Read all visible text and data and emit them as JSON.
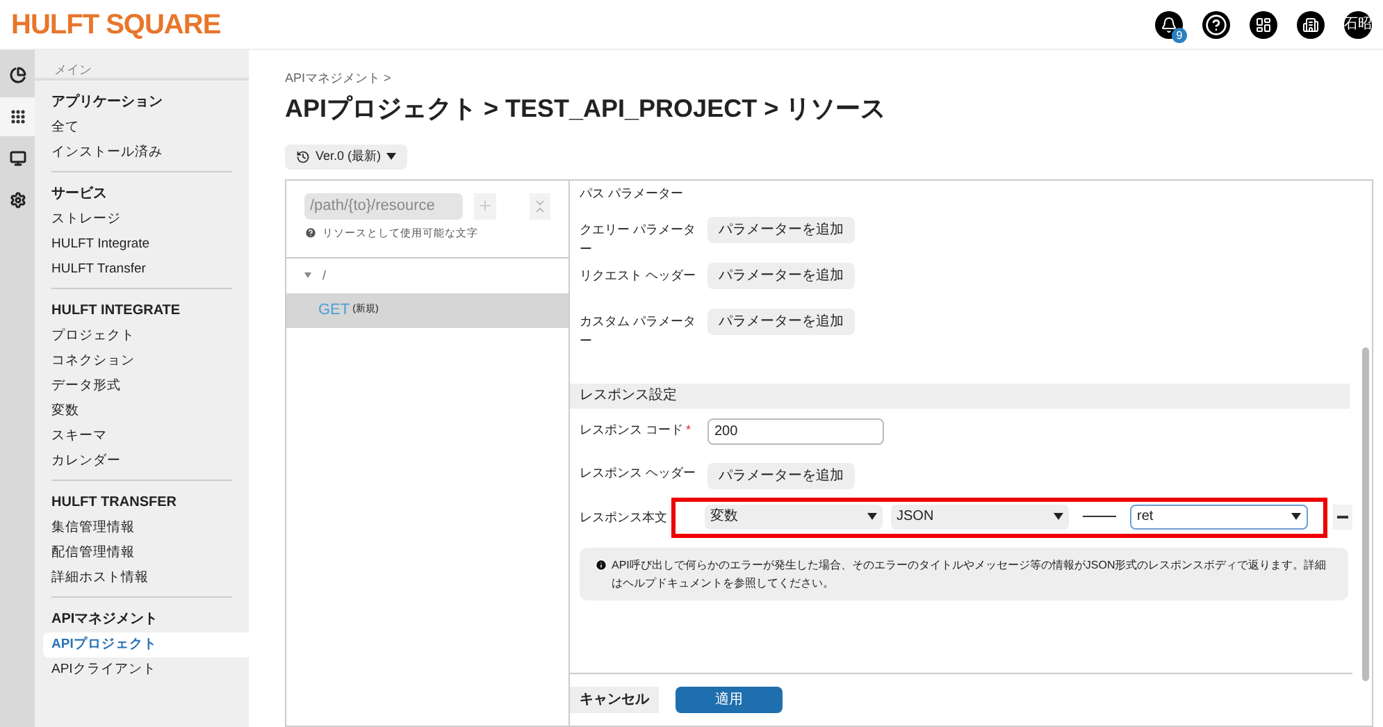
{
  "header": {
    "logo": "HULFT SQUARE",
    "notification_count": "9",
    "user": "石昭"
  },
  "rail": [
    {
      "kind": "chart",
      "selected": false
    },
    {
      "kind": "apps",
      "selected": true
    },
    {
      "kind": "monitor",
      "selected": false
    },
    {
      "kind": "settings",
      "selected": false
    }
  ],
  "sidebar": {
    "top_label": "メイン",
    "groups": [
      {
        "heading": "アプリケーション",
        "items": [
          {
            "label": "全て",
            "selected": false
          },
          {
            "label": "インストール済み",
            "selected": false
          }
        ]
      },
      {
        "heading": "サービス",
        "items": [
          {
            "label": "ストレージ",
            "selected": false
          },
          {
            "label": "HULFT Integrate",
            "selected": false
          },
          {
            "label": "HULFT Transfer",
            "selected": false
          }
        ]
      },
      {
        "heading": "HULFT INTEGRATE",
        "items": [
          {
            "label": "プロジェクト",
            "selected": false
          },
          {
            "label": "コネクション",
            "selected": false
          },
          {
            "label": "データ形式",
            "selected": false
          },
          {
            "label": "変数",
            "selected": false
          },
          {
            "label": "スキーマ",
            "selected": false
          },
          {
            "label": "カレンダー",
            "selected": false
          }
        ]
      },
      {
        "heading": "HULFT TRANSFER",
        "items": [
          {
            "label": "集信管理情報",
            "selected": false
          },
          {
            "label": "配信管理情報",
            "selected": false
          },
          {
            "label": "詳細ホスト情報",
            "selected": false
          }
        ]
      },
      {
        "heading": "APIマネジメント",
        "items": [
          {
            "label": "APIプロジェクト",
            "selected": true
          },
          {
            "label": "APIクライアント",
            "selected": false
          }
        ]
      }
    ]
  },
  "breadcrumb": "APIマネジメント >",
  "title": "APIプロジェクト > TEST_API_PROJECT > リソース",
  "version": "Ver.0 (最新)",
  "resource_panel": {
    "path_placeholder": "/path/{to}/resource",
    "hint": "リソースとして使用可能な文字",
    "tree": [
      {
        "label": "/",
        "expanded": true,
        "children": [
          {
            "method": "GET",
            "note": "(新規)",
            "selected": true
          }
        ]
      }
    ]
  },
  "request": {
    "path_params_label": "パス パラメーター",
    "rows": [
      {
        "label": "クエリー パラメーター",
        "button": "パラメーターを追加"
      },
      {
        "label": "リクエスト ヘッダー",
        "button": "パラメーターを追加"
      },
      {
        "label": "カスタム パラメーター",
        "button": "パラメーターを追加"
      }
    ]
  },
  "response": {
    "heading": "レスポンス設定",
    "code_label": "レスポンス コード",
    "required_mark": "*",
    "code_value": "200",
    "header_label": "レスポンス ヘッダー",
    "header_button": "パラメーターを追加",
    "body_label": "レスポンス本文",
    "body_selects": [
      {
        "value": "変数",
        "focused": false
      },
      {
        "value": "JSON",
        "focused": false
      },
      {
        "value": "ret",
        "focused": true
      }
    ],
    "info": "API呼び出しで何らかのエラーが発生した場合、そのエラーのタイトルやメッセージ等の情報がJSON形式のレスポンスボディで返ります。詳細はヘルプドキュメントを参照してください。"
  },
  "buttons": {
    "cancel": "キャンセル",
    "apply": "適用"
  }
}
